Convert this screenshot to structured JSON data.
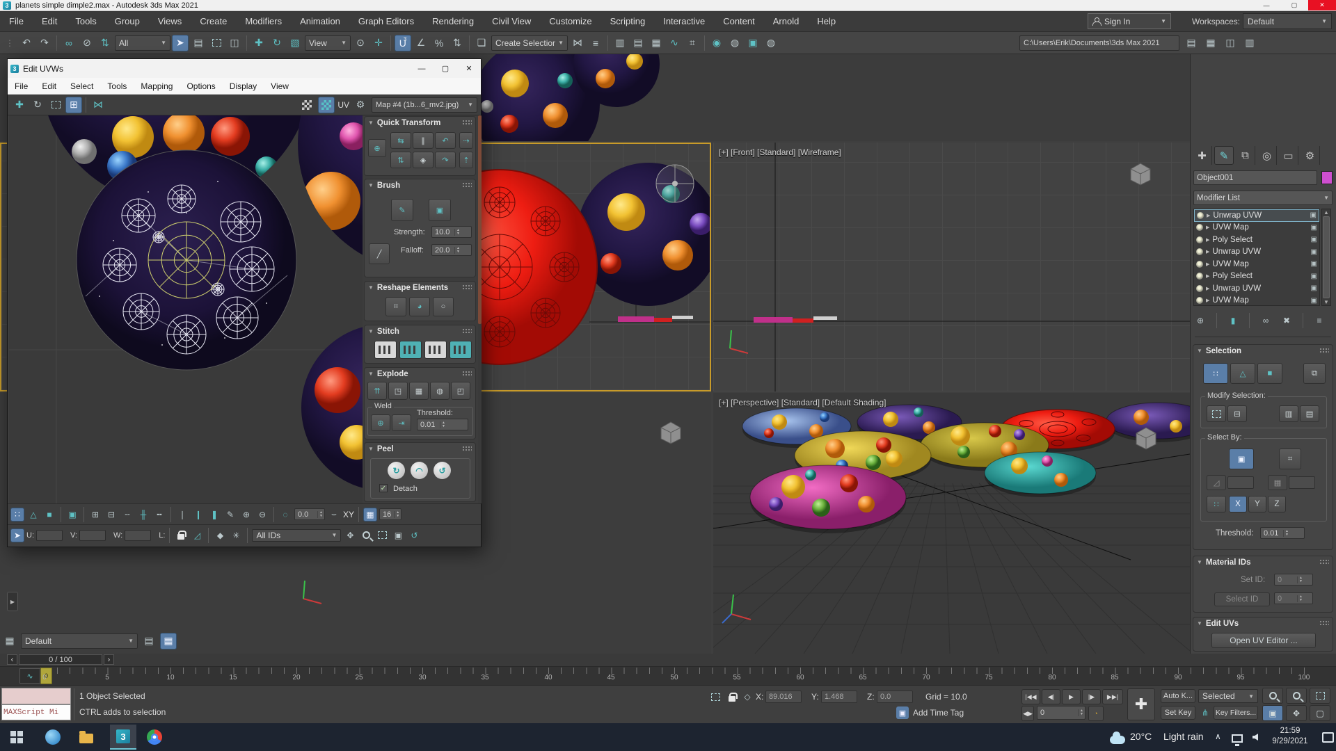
{
  "app": {
    "title": "planets simple dimple2.max - Autodesk 3ds Max 2021",
    "badge": "3"
  },
  "menu": {
    "items": [
      "File",
      "Edit",
      "Tools",
      "Group",
      "Views",
      "Create",
      "Modifiers",
      "Animation",
      "Graph Editors",
      "Rendering",
      "Civil View",
      "Customize",
      "Scripting",
      "Interactive",
      "Content",
      "Arnold",
      "Help"
    ]
  },
  "account": {
    "sign_in": "Sign In"
  },
  "workspaces": {
    "label": "Workspaces:",
    "value": "Default"
  },
  "toolbar": {
    "filter": "All",
    "ref_coord": "View",
    "snap": "3",
    "percent": "%",
    "named_sets": "Create Selection Se",
    "path": "C:\\Users\\Erik\\Documents\\3ds Max 2021"
  },
  "uvw": {
    "title": "Edit UVWs",
    "menus": [
      "File",
      "Edit",
      "Select",
      "Tools",
      "Mapping",
      "Options",
      "Display",
      "View"
    ],
    "uv": "UV",
    "map": "Map #4 (1b...6_mv2.jpg)",
    "quick_transform": "Quick Transform",
    "brush": "Brush",
    "strength_label": "Strength:",
    "strength": "10.0",
    "falloff_label": "Falloff:",
    "falloff": "20.0",
    "reshape": "Reshape Elements",
    "stitch": "Stitch",
    "explode": "Explode",
    "weld": "Weld",
    "threshold_label": "Threshold:",
    "threshold": "0.01",
    "peel": "Peel",
    "detach": "Detach",
    "soft_value": "0.0",
    "xy": "XY",
    "grid_size": "16",
    "u": "U:",
    "v": "V:",
    "w": "W:",
    "l": "L:",
    "all_ids": "All IDs"
  },
  "viewports": {
    "front_label": "[+] [Front] [Standard] [Wireframe]",
    "persp_label": "[+] [Perspective] [Standard] [Default Shading]"
  },
  "panel": {
    "object_name": "Object001",
    "modifier_list": "Modifier List",
    "stack": [
      "Unwrap UVW",
      "UVW Map",
      "Poly Select",
      "Unwrap UVW",
      "UVW Map",
      "Poly Select",
      "Unwrap UVW",
      "UVW Map"
    ],
    "selection": "Selection",
    "modify_selection": "Modify Selection:",
    "select_by": "Select By:",
    "x": "X",
    "y": "Y",
    "z": "Z",
    "threshold_label": "Threshold:",
    "threshold": "0.01",
    "material_ids": "Material IDs",
    "set_id_label": "Set ID:",
    "set_id": "0",
    "select_id_label": "Select ID",
    "select_id": "0",
    "edit_uvs": "Edit UVs",
    "open_uv_editor": "Open UV Editor ..."
  },
  "layer_bar": {
    "value": "Default"
  },
  "track": {
    "range": "0 / 100"
  },
  "timeline": {
    "slider": "0",
    "ticks": [
      "0",
      "5",
      "10",
      "15",
      "20",
      "25",
      "30",
      "35",
      "40",
      "45",
      "50",
      "55",
      "60",
      "65",
      "70",
      "75",
      "80",
      "85",
      "90",
      "95",
      "100"
    ]
  },
  "status": {
    "maxscript": "MAXScript Mi",
    "line1": "1 Object Selected",
    "line2": "CTRL adds to selection",
    "x_label": "X:",
    "x": "89.016",
    "y_label": "Y:",
    "y": "1.468",
    "z_label": "Z:",
    "z": "0.0",
    "grid": "Grid = 10.0",
    "add_time_tag": "Add Time Tag",
    "frame": "0",
    "auto_key": "Auto K...",
    "set_key": "Set Key",
    "key_filter_mode": "Selected",
    "key_filters": "Key Filters..."
  },
  "taskbar": {
    "temp": "20°C",
    "condition": "Light rain",
    "time": "21:59",
    "date": "9/29/2021"
  }
}
